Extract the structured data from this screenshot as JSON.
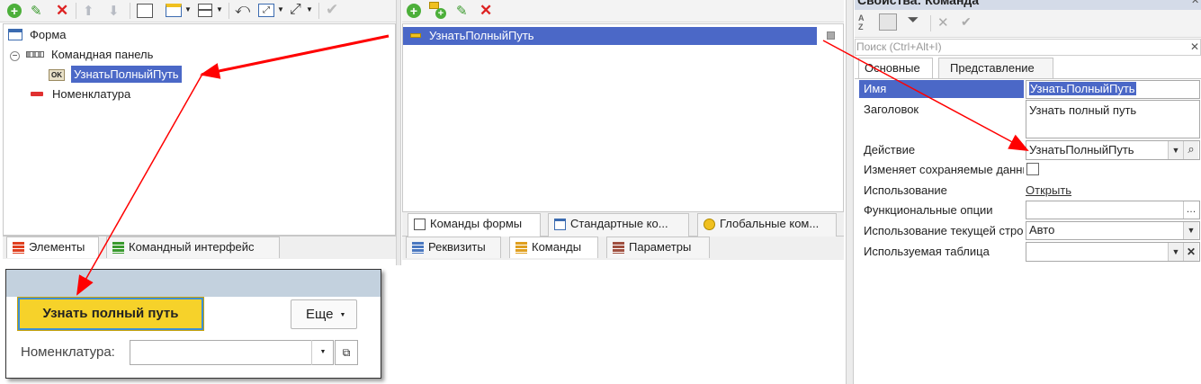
{
  "left_tree": {
    "items": [
      {
        "label": "Форма"
      },
      {
        "label": "Командная панель"
      },
      {
        "label": "УзнатьПолныйПуть"
      },
      {
        "label": "Номенклатура"
      }
    ],
    "tabs": [
      "Элементы",
      "Командный интерфейс"
    ]
  },
  "middle_panel": {
    "selected_command": "УзнатьПолныйПуть",
    "sub_tabs": [
      "Команды формы",
      "Стандартные ко...",
      "Глобальные ком..."
    ],
    "bottom_tabs": [
      "Реквизиты",
      "Команды",
      "Параметры"
    ]
  },
  "form_preview": {
    "main_button": "Узнать полный путь",
    "more_button": "Еще",
    "field_label": "Номенклатура:"
  },
  "properties": {
    "title": "Свойства: Команда",
    "search_placeholder": "Поиск (Ctrl+Alt+I)",
    "tabs": [
      "Основные",
      "Представление"
    ],
    "rows": {
      "name_label": "Имя",
      "name_value": "УзнатьПолныйПуть",
      "title_label": "Заголовок",
      "title_value": "Узнать полный путь",
      "action_label": "Действие",
      "action_value": "УзнатьПолныйПуть",
      "modifies_label": "Изменяет сохраняемые данные",
      "usage_label": "Использование",
      "usage_link": "Открыть",
      "functional_label": "Функциональные опции",
      "usage_current_label": "Использование текущей строки",
      "usage_current_value": "Авто",
      "table_label": "Используемая таблица"
    }
  },
  "colors": {
    "selection": "#4b68c7",
    "accent_yellow": "#f6d22a",
    "arrow": "#ff0000"
  }
}
